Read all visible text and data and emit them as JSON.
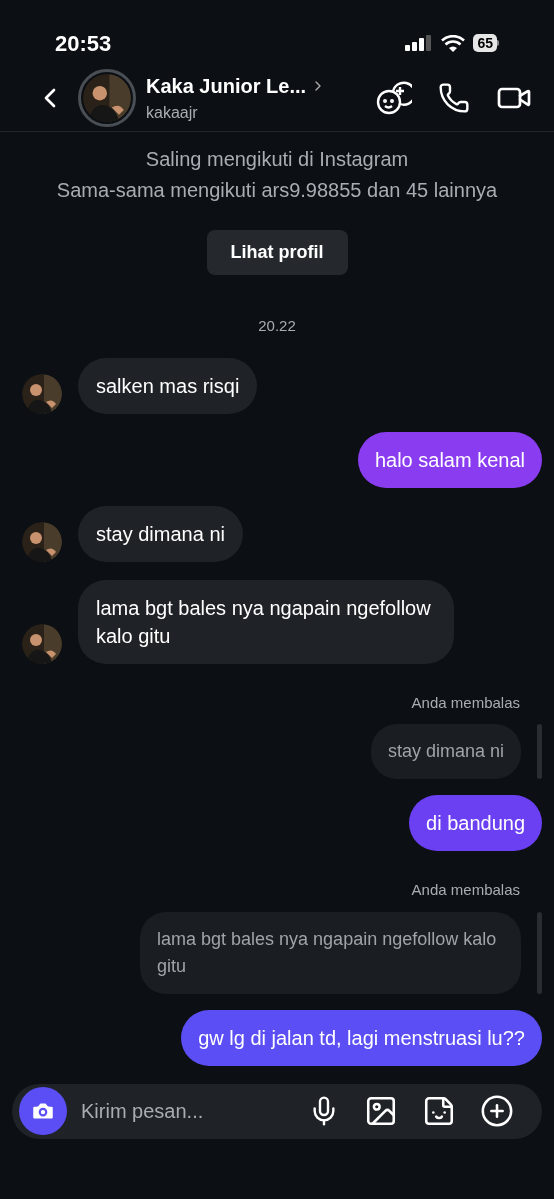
{
  "status_bar": {
    "time": "20:53",
    "battery": "65"
  },
  "header": {
    "name": "Kaka Junior Le...",
    "username": "kakaajr"
  },
  "profile": {
    "lines": [
      "Saling mengikuti di Instagram",
      "Sama-sama mengikuti ars9.98855 dan 45 lainnya"
    ],
    "button": "Lihat profil"
  },
  "timestamp": "20.22",
  "messages": [
    {
      "kind": "incoming",
      "text": "salken mas risqi"
    },
    {
      "kind": "outgoing",
      "text": "halo salam kenal",
      "color": "#8a3cf0"
    },
    {
      "kind": "incoming",
      "text": "stay dimana ni"
    },
    {
      "kind": "incoming",
      "text": "lama bgt bales nya ngapain ngefollow kalo gitu"
    },
    {
      "kind": "reply_label",
      "text": "Anda membalas"
    },
    {
      "kind": "quote",
      "text": "stay dimana ni"
    },
    {
      "kind": "outgoing",
      "text": "di bandung",
      "color": "#6b3ff2"
    },
    {
      "kind": "reply_label",
      "text": "Anda membalas"
    },
    {
      "kind": "quote",
      "text": "lama bgt bales nya ngapain ngefollow kalo gitu"
    },
    {
      "kind": "outgoing",
      "text": "gw lg di jalan td, lagi menstruasi lu??",
      "color": "#5b4ef5"
    }
  ],
  "composer": {
    "placeholder": "Kirim pesan..."
  }
}
